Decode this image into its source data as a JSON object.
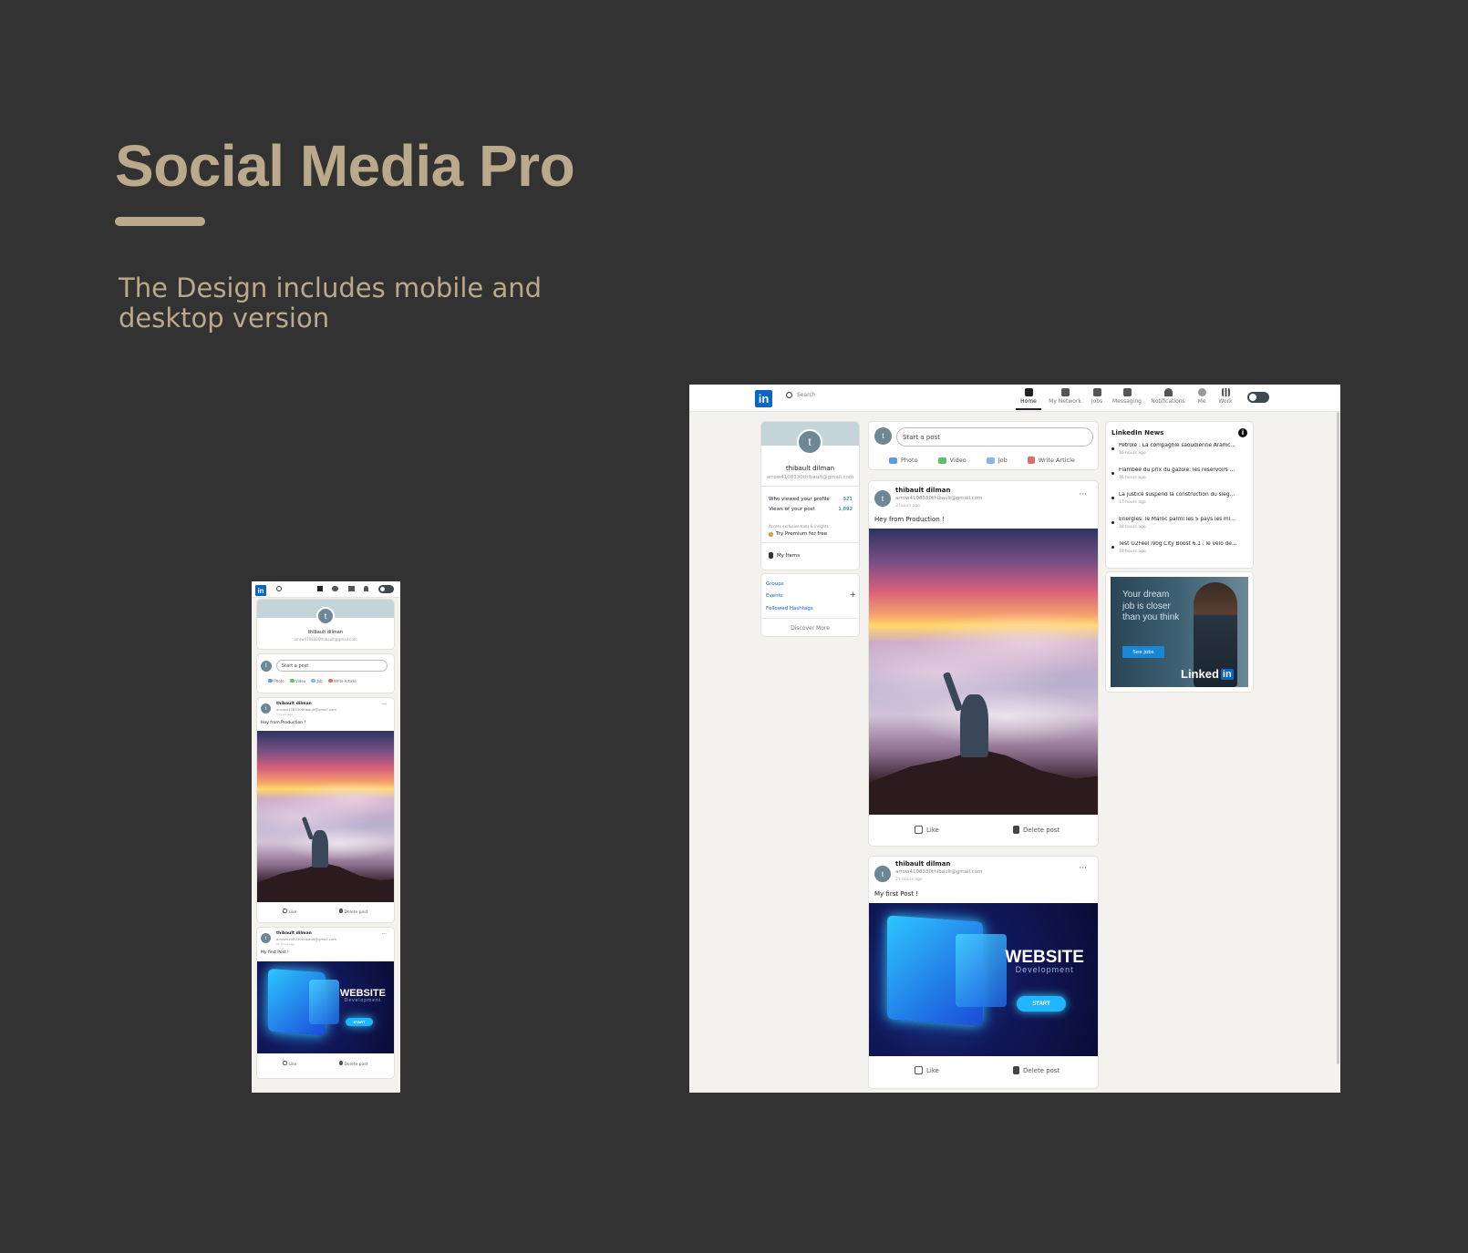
{
  "hero": {
    "title": "Social Media Pro",
    "subtitle": "The Design includes mobile and desktop version"
  },
  "app": {
    "logo": "in",
    "search_placeholder": "Search",
    "nav": [
      {
        "label": "Home",
        "icon": "home-icon",
        "active": true
      },
      {
        "label": "My Network",
        "icon": "network-icon"
      },
      {
        "label": "Jobs",
        "icon": "briefcase-icon"
      },
      {
        "label": "Messaging",
        "icon": "message-icon"
      },
      {
        "label": "Notifications",
        "icon": "bell-icon"
      },
      {
        "label": "Me",
        "icon": "user-icon"
      },
      {
        "label": "Work",
        "icon": "grid-icon"
      }
    ],
    "profile": {
      "initial": "t",
      "name": "thibault dilman",
      "email": "arrow4108330thibault@gmail.com",
      "viewed_label": "Who viewed your profile",
      "viewed_value": "321",
      "views_label": "Views of your post",
      "views_value": "1,892",
      "premium_note": "Access exclusive tools & insights",
      "premium_cta": "Try Premium for free",
      "my_items": "My Items"
    },
    "community": {
      "groups": "Groups",
      "events": "Events",
      "hashtags": "Followed Hashtags",
      "discover": "Discover More",
      "add": "+"
    },
    "share": {
      "placeholder": "Start a post",
      "photo": "Photo",
      "video": "Video",
      "job": "Job",
      "article": "Write Article"
    },
    "posts": [
      {
        "author": "thibault dilman",
        "email": "arrow4108330thibault@gmail.com",
        "time": "3 hours ago",
        "text": "Hey from Production !",
        "like": "Like",
        "delete": "Delete post",
        "more": "···"
      },
      {
        "author": "thibault dilman",
        "email": "arrow4108330thibault@gmail.com",
        "time": "21 hours ago",
        "text": "My first Post !",
        "like": "Like",
        "delete": "Delete post",
        "more": "···",
        "image_title": "WEBSITE",
        "image_subtitle": "Development",
        "image_button": "START"
      }
    ],
    "news": {
      "title": "LinkedIn News",
      "items": [
        {
          "headline": "Pétrole : La compagnie saoudienne Aramc...",
          "time": "16 hours ago"
        },
        {
          "headline": "Flambée du prix du gazole: les réservoirs ...",
          "time": "16 hours ago"
        },
        {
          "headline": "La justice suspend la construction du sièg...",
          "time": "17 hours ago"
        },
        {
          "headline": "Énergies: le Maroc parmi les 5 pays les mi...",
          "time": "18 hours ago"
        },
        {
          "headline": "Test O2Feel iVog City Boost 6.1 : le vélo de...",
          "time": "19 hours ago"
        }
      ]
    },
    "ad": {
      "text": "Your dream job is closer than you think",
      "button": "See jobs",
      "brand": "Linked"
    }
  },
  "colors": {
    "background": "#333232",
    "accent": "#bba98b",
    "brand": "#0a66c2",
    "feed_bg": "#f3f2ef"
  }
}
